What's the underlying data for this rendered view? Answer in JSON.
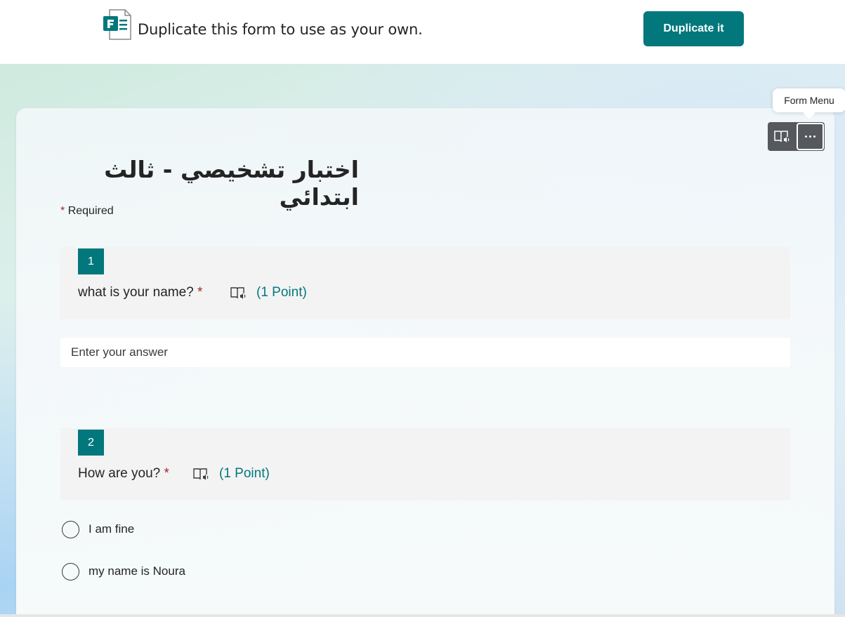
{
  "banner": {
    "logo_icon": "microsoft-forms-icon",
    "text": "Duplicate this form to use as your own.",
    "button_label": "Duplicate it"
  },
  "tooltip": {
    "text": "Form Menu"
  },
  "toolbar": {
    "read_icon": "immersive-reader-icon",
    "more_icon": "more-options-icon"
  },
  "form": {
    "title": "اختبار تشخيصي - ثالث ابتدائي",
    "required_star": "*",
    "required_label": "Required"
  },
  "questions": [
    {
      "number": "1",
      "text": "what is your name?",
      "required_star": "*",
      "points": "(1 Point)",
      "answer_placeholder": "Enter your answer"
    },
    {
      "number": "2",
      "text": "How are you?",
      "required_star": "*",
      "points": "(1 Point)",
      "options": [
        "I am fine",
        "my name is Noura"
      ]
    }
  ],
  "colors": {
    "accent": "#03787c",
    "required": "#a4262c",
    "toolbar": "#55595d"
  }
}
